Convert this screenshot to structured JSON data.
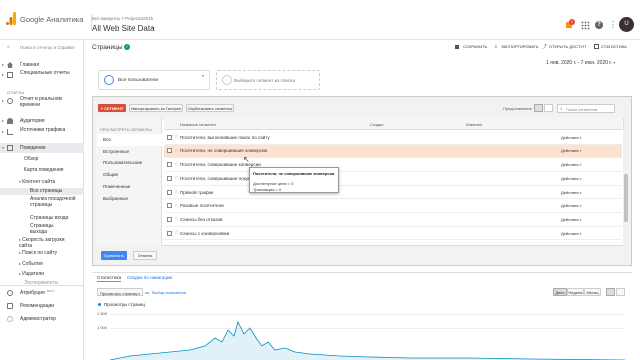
{
  "header": {
    "logo_text": "Google Аналитика",
    "breadcrumb": "Все аккаунты > Projector2015",
    "view_name": "All Web Site Data",
    "avatar_letter": "U",
    "bell_count": "1"
  },
  "sidebar": {
    "search_placeholder": "Поиск в отчетах и Справке",
    "items": [
      {
        "label": "Главная"
      },
      {
        "label": "Специальные отчеты"
      },
      {
        "section": "ОТЧЕТЫ"
      },
      {
        "label": "Отчет в реальном времени"
      },
      {
        "label": "Аудитория"
      },
      {
        "label": "Источники трафика"
      },
      {
        "label": "Поведение"
      }
    ],
    "behavior_sub": [
      "Обзор",
      "Карта поведения",
      "Контент сайта",
      "Все страницы",
      "Анализ посадочной страницы",
      "Страницы входа",
      "Страницы выхода",
      "Скорость загрузки сайта",
      "Поиск по сайту",
      "События",
      "Издатели",
      "Эксперименты"
    ],
    "bottom": [
      "Атрибуция",
      "BETA",
      "Рекомендации",
      "Администратор"
    ]
  },
  "page": {
    "title": "Страницы",
    "actions": [
      "СОХРАНИТЬ",
      "ЭКСПОРТИРОВАТЬ",
      "ОТКРЫТЬ ДОСТУП",
      "СТАТИСТИКА"
    ],
    "date_range": "1 янв. 2020 г. - 7 июн. 2020 г.",
    "segment_all": "Все пользователи",
    "segment_pick": "Выберите сегмент из списка"
  },
  "segment_panel": {
    "new_button": "+ СЕГМЕНТ",
    "import_button": "Импортировать из Галереи",
    "share_button": "Опубликовать сегменты",
    "view_label": "Представление",
    "search_placeholder": "Поиск сегментов",
    "filter_header": "ПРОСМОТРЕТЬ СЕГМЕНТЫ",
    "categories": [
      "Все",
      "Встроенные",
      "Пользовательские",
      "Общие",
      "Помеченные",
      "Выбранные"
    ],
    "col_name": "Название сегмента",
    "col_created": "Создан",
    "col_changed": "Изменен",
    "action_label": "Действия",
    "rows": [
      "Посетители, выполнявшие поиск по сайту",
      "Посетители, не совершившие конверсии",
      "Посетители, совершившие конверсии",
      "Посетители, совершившие покупку",
      "Прямой трафик",
      "Разовые посетители",
      "Сеансы без отказов",
      "Сеансы с конверсиями"
    ],
    "apply": "Применить",
    "cancel": "Отмена"
  },
  "tooltip": {
    "title": "Посетители, не совершившие конверсии",
    "line1": "Достигнутые цели = 0",
    "line2": "Транзакции = 0"
  },
  "bottom": {
    "tab1": "Статистика",
    "tab2": "Сводка по навигации",
    "metric_select": "Просмотры страниц",
    "vs": "vs.",
    "pick_metric": "Выбор показателя",
    "granularity": [
      "День",
      "Неделя",
      "Месяц"
    ],
    "legend": "Просмотры страниц",
    "y_labels": [
      "1 500",
      "1 000"
    ]
  },
  "colors": {
    "accent_orange": "#e8711c",
    "red_button": "#dd4b39",
    "blue_button": "#4285f4",
    "highlight_row": "#fde3cf",
    "chart_line": "#058dc7"
  }
}
